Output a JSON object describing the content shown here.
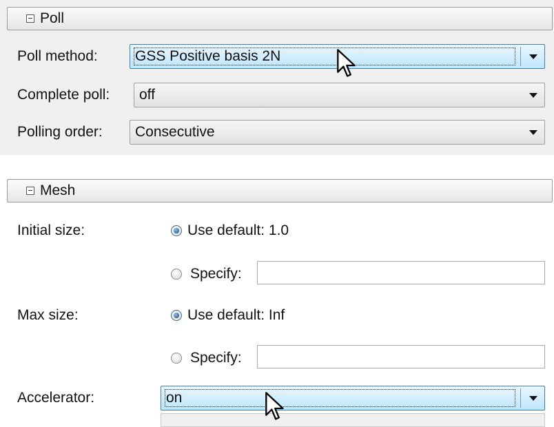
{
  "poll": {
    "header": "Poll",
    "poll_method": {
      "label": "Poll method:",
      "value": "GSS Positive basis 2N"
    },
    "complete_poll": {
      "label": "Complete poll:",
      "value": "off"
    },
    "polling_order": {
      "label": "Polling order:",
      "value": "Consecutive"
    }
  },
  "mesh": {
    "header": "Mesh",
    "initial_size": {
      "label": "Initial size:",
      "default_option": "Use default: 1.0",
      "specify_option": "Specify:",
      "specify_value": "",
      "selected": "default"
    },
    "max_size": {
      "label": "Max size:",
      "default_option": "Use default: Inf",
      "specify_option": "Specify:",
      "specify_value": "",
      "selected": "default"
    },
    "accelerator": {
      "label": "Accelerator:",
      "value": "on"
    }
  },
  "icons": {
    "collapse": "collapse-minus-icon",
    "dropdown": "chevron-down-icon",
    "pointer": "mouse-pointer-icon"
  },
  "colors": {
    "panel_bg": "#f0f0f0",
    "hover_dropdown_top": "#eaf6fd",
    "hover_dropdown_bottom": "#bee6fd",
    "hover_border": "#3c7fb1"
  }
}
